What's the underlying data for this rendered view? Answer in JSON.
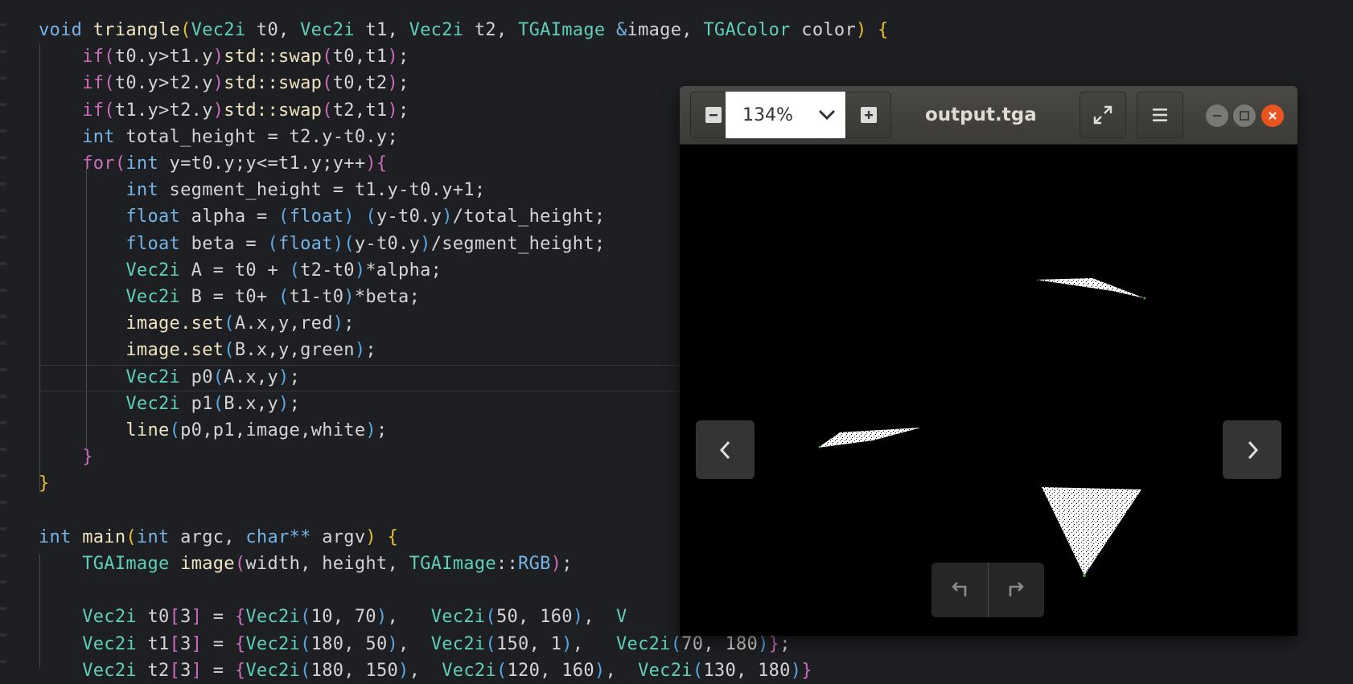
{
  "editor": {
    "lines": [
      [
        [
          "kw",
          "void"
        ],
        [
          "txt",
          " "
        ],
        [
          "fn",
          "triangle"
        ],
        [
          "par",
          "("
        ],
        [
          "ty",
          "Vec2i"
        ],
        [
          "txt",
          " t0, "
        ],
        [
          "ty",
          "Vec2i"
        ],
        [
          "txt",
          " t1, "
        ],
        [
          "ty",
          "Vec2i"
        ],
        [
          "txt",
          " t2, "
        ],
        [
          "ty",
          "TGAImage"
        ],
        [
          "txt",
          " "
        ],
        [
          "amp",
          "&"
        ],
        [
          "txt",
          "image, "
        ],
        [
          "ty",
          "TGAColor"
        ],
        [
          "txt",
          " color"
        ],
        [
          "par",
          ")"
        ],
        [
          "txt",
          " "
        ],
        [
          "par",
          "{"
        ]
      ],
      [
        [
          "txt",
          "    "
        ],
        [
          "par2",
          "if"
        ],
        [
          "par2",
          "("
        ],
        [
          "txt",
          "t0.y>t1.y"
        ],
        [
          "par2",
          ")"
        ],
        [
          "fn",
          "std::swap"
        ],
        [
          "par2",
          "("
        ],
        [
          "txt",
          "t0,t1"
        ],
        [
          "par2",
          ")"
        ],
        [
          "txt",
          ";"
        ]
      ],
      [
        [
          "txt",
          "    "
        ],
        [
          "par2",
          "if"
        ],
        [
          "par2",
          "("
        ],
        [
          "txt",
          "t0.y>t2.y"
        ],
        [
          "par2",
          ")"
        ],
        [
          "fn",
          "std::swap"
        ],
        [
          "par2",
          "("
        ],
        [
          "txt",
          "t0,t2"
        ],
        [
          "par2",
          ")"
        ],
        [
          "txt",
          ";"
        ]
      ],
      [
        [
          "txt",
          "    "
        ],
        [
          "par2",
          "if"
        ],
        [
          "par2",
          "("
        ],
        [
          "txt",
          "t1.y>t2.y"
        ],
        [
          "par2",
          ")"
        ],
        [
          "fn",
          "std::swap"
        ],
        [
          "par2",
          "("
        ],
        [
          "txt",
          "t2,t1"
        ],
        [
          "par2",
          ")"
        ],
        [
          "txt",
          ";"
        ]
      ],
      [
        [
          "txt",
          "    "
        ],
        [
          "kw",
          "int"
        ],
        [
          "txt",
          " total_height = t2.y-t0.y;"
        ]
      ],
      [
        [
          "txt",
          "    "
        ],
        [
          "par2",
          "for"
        ],
        [
          "par2",
          "("
        ],
        [
          "kw",
          "int"
        ],
        [
          "txt",
          " y=t0.y;y<=t1.y;y++"
        ],
        [
          "par2",
          ")"
        ],
        [
          "par2",
          "{"
        ]
      ],
      [
        [
          "txt",
          "        "
        ],
        [
          "kw",
          "int"
        ],
        [
          "txt",
          " segment_height = t1.y-t0.y+1;"
        ]
      ],
      [
        [
          "txt",
          "        "
        ],
        [
          "kw",
          "float"
        ],
        [
          "txt",
          " alpha = "
        ],
        [
          "par3",
          "("
        ],
        [
          "kw",
          "float"
        ],
        [
          "par3",
          ")"
        ],
        [
          "txt",
          " "
        ],
        [
          "par3",
          "("
        ],
        [
          "txt",
          "y-t0.y"
        ],
        [
          "par3",
          ")"
        ],
        [
          "txt",
          "/total_height;"
        ]
      ],
      [
        [
          "txt",
          "        "
        ],
        [
          "kw",
          "float"
        ],
        [
          "txt",
          " beta = "
        ],
        [
          "par3",
          "("
        ],
        [
          "kw",
          "float"
        ],
        [
          "par3",
          ")"
        ],
        [
          "par3",
          "("
        ],
        [
          "txt",
          "y-t0.y"
        ],
        [
          "par3",
          ")"
        ],
        [
          "txt",
          "/segment_height;"
        ]
      ],
      [
        [
          "txt",
          "        "
        ],
        [
          "ty",
          "Vec2i"
        ],
        [
          "txt",
          " A = t0 + "
        ],
        [
          "par3",
          "("
        ],
        [
          "txt",
          "t2-t0"
        ],
        [
          "par3",
          ")"
        ],
        [
          "txt",
          "*alpha;"
        ]
      ],
      [
        [
          "txt",
          "        "
        ],
        [
          "ty",
          "Vec2i"
        ],
        [
          "txt",
          " B = t0+ "
        ],
        [
          "par3",
          "("
        ],
        [
          "txt",
          "t1-t0"
        ],
        [
          "par3",
          ")"
        ],
        [
          "txt",
          "*beta;"
        ]
      ],
      [
        [
          "txt",
          "        "
        ],
        [
          "fn",
          "image.set"
        ],
        [
          "par3",
          "("
        ],
        [
          "txt",
          "A.x,y,red"
        ],
        [
          "par3",
          ")"
        ],
        [
          "txt",
          ";"
        ]
      ],
      [
        [
          "txt",
          "        "
        ],
        [
          "fn",
          "image.set"
        ],
        [
          "par3",
          "("
        ],
        [
          "txt",
          "B.x,y,green"
        ],
        [
          "par3",
          ")"
        ],
        [
          "txt",
          ";"
        ]
      ],
      [
        [
          "txt",
          "        "
        ],
        [
          "ty",
          "Vec2i"
        ],
        [
          "txt",
          " p0"
        ],
        [
          "par3",
          "("
        ],
        [
          "txt",
          "A.x,y"
        ],
        [
          "par3",
          ")"
        ],
        [
          "txt",
          ";"
        ]
      ],
      [
        [
          "txt",
          "        "
        ],
        [
          "ty",
          "Vec2i"
        ],
        [
          "txt",
          " p1"
        ],
        [
          "par3",
          "("
        ],
        [
          "txt",
          "B.x,y"
        ],
        [
          "par3",
          ")"
        ],
        [
          "txt",
          ";"
        ]
      ],
      [
        [
          "txt",
          "        "
        ],
        [
          "fn",
          "line"
        ],
        [
          "par3",
          "("
        ],
        [
          "txt",
          "p0,p1,image,white"
        ],
        [
          "par3",
          ")"
        ],
        [
          "txt",
          ";"
        ]
      ],
      [
        [
          "txt",
          "    "
        ],
        [
          "par2",
          "}"
        ]
      ],
      [
        [
          "par",
          "}"
        ]
      ],
      [],
      [
        [
          "kw",
          "int"
        ],
        [
          "txt",
          " "
        ],
        [
          "fn",
          "main"
        ],
        [
          "par",
          "("
        ],
        [
          "kw",
          "int"
        ],
        [
          "txt",
          " argc, "
        ],
        [
          "kw",
          "char**"
        ],
        [
          "txt",
          " argv"
        ],
        [
          "par",
          ")"
        ],
        [
          "txt",
          " "
        ],
        [
          "par",
          "{"
        ]
      ],
      [
        [
          "txt",
          "    "
        ],
        [
          "ty",
          "TGAImage"
        ],
        [
          "txt",
          " "
        ],
        [
          "fn",
          "image"
        ],
        [
          "par2",
          "("
        ],
        [
          "txt",
          "width, height, "
        ],
        [
          "ty",
          "TGAImage"
        ],
        [
          "txt",
          "::"
        ],
        [
          "kw",
          "RGB"
        ],
        [
          "par2",
          ")"
        ],
        [
          "txt",
          ";"
        ]
      ],
      [],
      [
        [
          "txt",
          "    "
        ],
        [
          "ty",
          "Vec2i"
        ],
        [
          "txt",
          " t0"
        ],
        [
          "par2",
          "["
        ],
        [
          "txt",
          "3"
        ],
        [
          "par2",
          "]"
        ],
        [
          "txt",
          " = "
        ],
        [
          "par2",
          "{"
        ],
        [
          "ty",
          "Vec2i"
        ],
        [
          "par3",
          "("
        ],
        [
          "txt",
          "10, 70"
        ],
        [
          "par3",
          ")"
        ],
        [
          "txt",
          ",   "
        ],
        [
          "ty",
          "Vec2i"
        ],
        [
          "par3",
          "("
        ],
        [
          "txt",
          "50, 160"
        ],
        [
          "par3",
          ")"
        ],
        [
          "txt",
          ",  "
        ],
        [
          "ty",
          "V"
        ]
      ],
      [
        [
          "txt",
          "    "
        ],
        [
          "ty",
          "Vec2i"
        ],
        [
          "txt",
          " t1"
        ],
        [
          "par2",
          "["
        ],
        [
          "txt",
          "3"
        ],
        [
          "par2",
          "]"
        ],
        [
          "txt",
          " = "
        ],
        [
          "par2",
          "{"
        ],
        [
          "ty",
          "Vec2i"
        ],
        [
          "par3",
          "("
        ],
        [
          "txt",
          "180, 50"
        ],
        [
          "par3",
          ")"
        ],
        [
          "txt",
          ",  "
        ],
        [
          "ty",
          "Vec2i"
        ],
        [
          "par3",
          "("
        ],
        [
          "txt",
          "150, 1"
        ],
        [
          "par3",
          ")"
        ],
        [
          "txt",
          ",   "
        ],
        [
          "ty",
          "Vec2i"
        ],
        [
          "par3",
          "("
        ],
        [
          "txt",
          "70, 180"
        ],
        [
          "par3",
          ")"
        ],
        [
          "par2",
          "}"
        ],
        [
          "txt",
          ";"
        ]
      ],
      [
        [
          "txt",
          "    "
        ],
        [
          "ty",
          "Vec2i"
        ],
        [
          "txt",
          " t2"
        ],
        [
          "par2",
          "["
        ],
        [
          "txt",
          "3"
        ],
        [
          "par2",
          "]"
        ],
        [
          "txt",
          " = "
        ],
        [
          "par2",
          "{"
        ],
        [
          "ty",
          "Vec2i"
        ],
        [
          "par3",
          "("
        ],
        [
          "txt",
          "180, 150"
        ],
        [
          "par3",
          ")"
        ],
        [
          "txt",
          ",  "
        ],
        [
          "ty",
          "Vec2i"
        ],
        [
          "par3",
          "("
        ],
        [
          "txt",
          "120, 160"
        ],
        [
          "par3",
          ")"
        ],
        [
          "txt",
          ",  "
        ],
        [
          "ty",
          "Vec2i"
        ],
        [
          "par3",
          "("
        ],
        [
          "txt",
          "130, 180"
        ],
        [
          "par3",
          ")"
        ],
        [
          "par2",
          "}"
        ]
      ]
    ]
  },
  "viewer": {
    "zoom": "134%",
    "title": "output.tga",
    "icons": {
      "zoom_out": "zoom-out-icon",
      "zoom_in": "zoom-in-icon",
      "dropdown": "chevron-down-icon",
      "fullscreen": "fullscreen-icon",
      "menu": "hamburger-menu-icon",
      "minimize": "minimize-icon",
      "maximize": "maximize-icon",
      "close": "close-icon",
      "prev": "previous-image-icon",
      "next": "next-image-icon",
      "rotate_left": "rotate-left-icon",
      "rotate_right": "rotate-right-icon"
    },
    "colors": {
      "close": "#e95420",
      "window_button": "#7a7873",
      "image_fill": "#ffffff",
      "image_bg": "#000000"
    }
  }
}
